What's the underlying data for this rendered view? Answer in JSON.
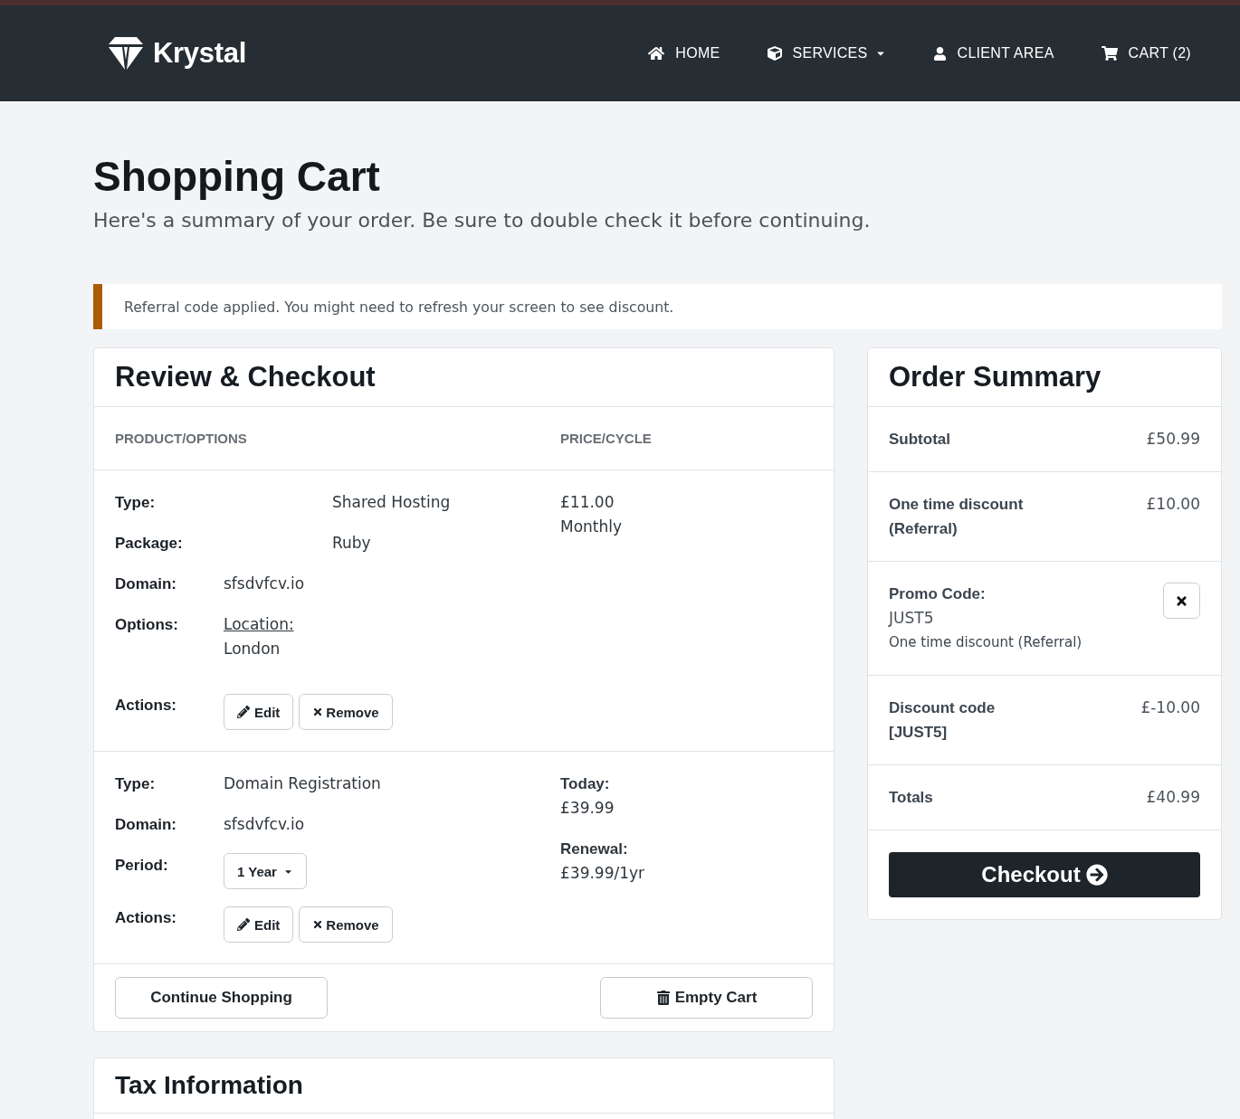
{
  "header": {
    "brand": "Krystal",
    "nav": [
      {
        "kind": "home",
        "label": "HOME",
        "dropdown": false
      },
      {
        "kind": "services",
        "label": "SERVICES",
        "dropdown": true
      },
      {
        "kind": "account",
        "label": "CLIENT AREA",
        "dropdown": false
      },
      {
        "kind": "cart",
        "label": "CART (2)",
        "dropdown": false
      }
    ]
  },
  "page": {
    "title": "Shopping Cart",
    "subtitle": "Here's a summary of your order. Be sure to double check it before continuing."
  },
  "alert": {
    "text": "Referral code applied. You might need to refresh your screen to see discount."
  },
  "review": {
    "title": "Review & Checkout",
    "columns": [
      "PRODUCT/OPTIONS",
      "PRICE/CYCLE"
    ],
    "items": [
      {
        "summary_fields": [
          {
            "label": "Type:",
            "value": "Shared Hosting"
          },
          {
            "label": "Package:",
            "value": "Ruby"
          }
        ],
        "fields": [
          {
            "kind": "text",
            "label": "Domain:",
            "value": "sfsdvfcv.io"
          },
          {
            "kind": "option",
            "label": "Options:",
            "option": "Location:",
            "value": "London"
          },
          {
            "kind": "actions",
            "label": "Actions:",
            "buttons": [
              {
                "kind": "edit",
                "label": "Edit"
              },
              {
                "kind": "remove",
                "label": "Remove"
              }
            ]
          }
        ],
        "price": [
          {
            "kind": "value",
            "text": "£11.00"
          },
          {
            "kind": "value",
            "text": "Monthly"
          }
        ]
      },
      {
        "fields": [
          {
            "kind": "text",
            "label": "Type:",
            "value": "Domain Registration"
          },
          {
            "kind": "text",
            "label": "Domain:",
            "value": "sfsdvfcv.io"
          },
          {
            "kind": "select",
            "label": "Period:",
            "value": "1 Year"
          },
          {
            "kind": "actions",
            "label": "Actions:",
            "buttons": [
              {
                "kind": "edit",
                "label": "Edit"
              },
              {
                "kind": "remove",
                "label": "Remove"
              }
            ]
          }
        ],
        "price": [
          {
            "kind": "label",
            "text": "Today:"
          },
          {
            "kind": "value",
            "text": "£39.99"
          },
          {
            "kind": "label",
            "text": "Renewal:"
          },
          {
            "kind": "value",
            "text": "£39.99/1yr"
          }
        ]
      }
    ],
    "buttons": [
      {
        "kind": "continue",
        "label": "Continue Shopping"
      },
      {
        "kind": "empty",
        "label": "Empty Cart"
      }
    ]
  },
  "summary": {
    "title": "Order Summary",
    "rows": [
      {
        "kind": "line",
        "label": "Subtotal",
        "value": "£50.99"
      },
      {
        "kind": "line",
        "label": "One time discount (Referral)",
        "value": "£10.00"
      },
      {
        "kind": "promo",
        "label": "Promo Code:",
        "code": "JUST5",
        "description": "One time discount (Referral)"
      },
      {
        "kind": "line",
        "label": "Discount code [JUST5]",
        "value": "£-10.00"
      },
      {
        "kind": "line",
        "label": "Totals",
        "value": "£40.99"
      }
    ],
    "checkout": "Checkout"
  },
  "tax": {
    "title": "Tax Information"
  }
}
